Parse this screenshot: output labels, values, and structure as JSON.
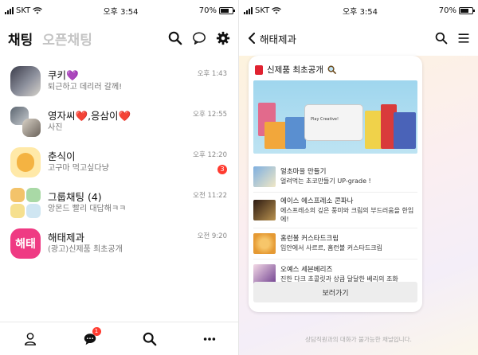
{
  "left": {
    "status": {
      "carrier": "SKT",
      "time": "오후 3:54",
      "battery": "70%",
      "battery_level": 0.7
    },
    "tabs": {
      "chats": "채팅",
      "open_chats": "오픈채팅"
    },
    "chats": [
      {
        "name": "쿠키💜",
        "message": "퇴근하고 데리러 갈께!",
        "time": "오후 1:43",
        "badge": ""
      },
      {
        "name": "영자씨❤️,응삼이❤️",
        "message": "사진",
        "time": "오후 12:55",
        "badge": ""
      },
      {
        "name": "춘식이",
        "message": "고구마 먹고싶다냥",
        "time": "오후 12:20",
        "badge": "3"
      },
      {
        "name": "그룹채팅 (4)",
        "message": "앙몬드 빨리 대답해ㅋㅋ",
        "time": "오전 11:22",
        "badge": ""
      },
      {
        "name": "해태제과",
        "message": "(광고)신제품 최초공개",
        "time": "오전 9:20",
        "badge": ""
      }
    ],
    "brand_avatar_text": "해태",
    "tabbar_badge": "1",
    "icons": [
      "person-icon",
      "chat-bubble-icon",
      "search-icon",
      "more-icon"
    ]
  },
  "right": {
    "status": {
      "carrier": "SKT",
      "time": "오후 3:54",
      "battery": "70%",
      "battery_level": 0.7
    },
    "title": "해태제과",
    "card": {
      "heading": "신제품 최초공개",
      "banner_text": "Play Creative!",
      "products": [
        {
          "title": "얼초마을 만들기",
          "desc": "얼려먹는 초코만들기 UP-grade !"
        },
        {
          "title": "에이스 에스프레소 콘파나",
          "desc": "에스프레소의 깊은 풍미와 크림의 부드러움을 한입에!"
        },
        {
          "title": "홈런볼 커스타드크림",
          "desc": "입안에서 사르르, 홈런볼 커스타드크림"
        },
        {
          "title": "오예스 세븐베리즈",
          "desc": "진한 다크 초콜릿과 상큼 달달한 베리의 조화"
        }
      ],
      "button": "보러가기"
    },
    "notice": "상담직원과의 대화가 불가능한 채널입니다."
  },
  "colors": {
    "badge": "#ff3b30",
    "brand": "#ef3a83",
    "haitai_red": "#e02230"
  }
}
